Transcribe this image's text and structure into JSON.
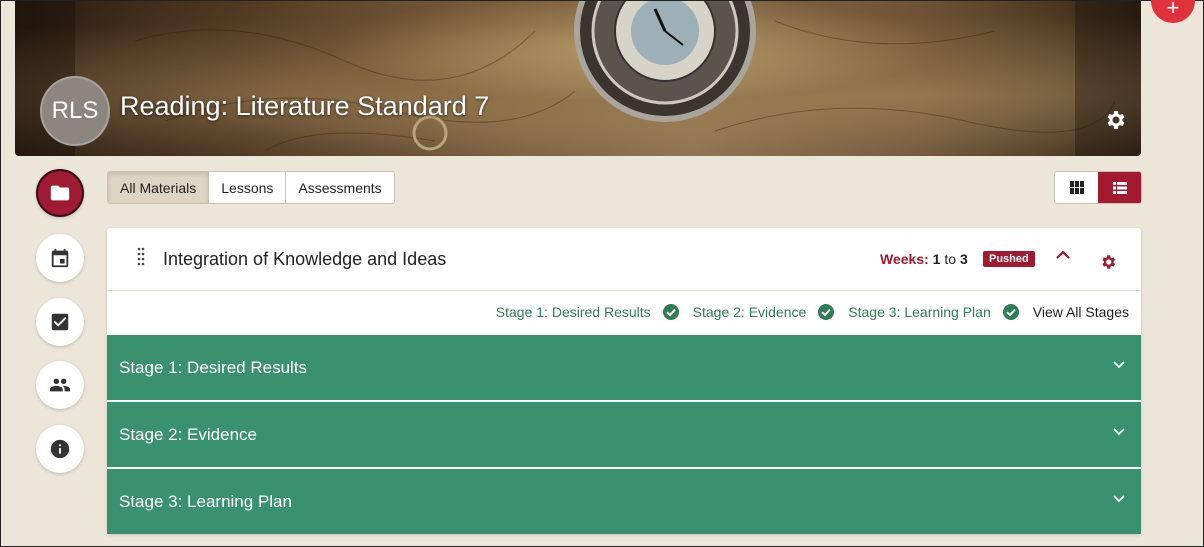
{
  "header": {
    "avatar_initials": "RLS",
    "course_title": "Reading: Literature Standard 7",
    "settings_icon": "gear-icon"
  },
  "fab": {
    "icon": "plus-icon"
  },
  "sidebar": {
    "items": [
      {
        "name": "materials",
        "icon": "folder-icon",
        "active": true
      },
      {
        "name": "calendar",
        "icon": "calendar-icon",
        "active": false
      },
      {
        "name": "tasks",
        "icon": "checkbox-icon",
        "active": false
      },
      {
        "name": "people",
        "icon": "people-icon",
        "active": false
      },
      {
        "name": "info",
        "icon": "info-icon",
        "active": false
      }
    ]
  },
  "filter_tabs": [
    {
      "label": "All Materials",
      "active": true
    },
    {
      "label": "Lessons",
      "active": false
    },
    {
      "label": "Assessments",
      "active": false
    }
  ],
  "view_toggle": {
    "options": [
      "grid-icon",
      "list-icon"
    ],
    "active": "list-icon"
  },
  "unit": {
    "title": "Integration of Knowledge and Ideas",
    "weeks_label": "Weeks:",
    "weeks_from": "1",
    "weeks_to_word": "to",
    "weeks_to": "3",
    "status_badge": "Pushed",
    "stage_status": [
      {
        "label": "Stage 1: Desired Results",
        "complete": true
      },
      {
        "label": "Stage 2: Evidence",
        "complete": true
      },
      {
        "label": "Stage 3: Learning Plan",
        "complete": true
      }
    ],
    "view_all_label": "View All Stages",
    "stages": [
      {
        "label": "Stage 1: Desired Results"
      },
      {
        "label": "Stage 2: Evidence"
      },
      {
        "label": "Stage 3: Learning Plan"
      }
    ]
  },
  "colors": {
    "accent": "#a3192f",
    "stage_green": "#3a9170",
    "status_green": "#2e7d56",
    "background": "#ece6d8"
  }
}
